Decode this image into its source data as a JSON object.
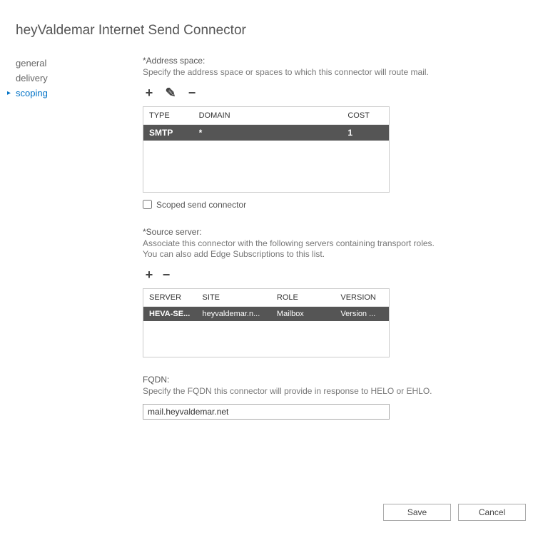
{
  "page_title": "heyValdemar Internet Send Connector",
  "sidebar": {
    "items": [
      {
        "label": "general"
      },
      {
        "label": "delivery"
      },
      {
        "label": "scoping"
      }
    ]
  },
  "address_space": {
    "label": "*Address space:",
    "help": "Specify the address space or spaces to which this connector will route mail.",
    "headers": {
      "type": "TYPE",
      "domain": "DOMAIN",
      "cost": "COST"
    },
    "rows": [
      {
        "type": "SMTP",
        "domain": "*",
        "cost": "1"
      }
    ],
    "scoped_label": "Scoped send connector"
  },
  "source_server": {
    "label": "*Source server:",
    "help": "Associate this connector with the following servers containing transport roles. You can also add Edge Subscriptions to this list.",
    "headers": {
      "server": "SERVER",
      "site": "SITE",
      "role": "ROLE",
      "version": "VERSION"
    },
    "rows": [
      {
        "server": "HEVA-SE...",
        "site": "heyvaldemar.n...",
        "role": "Mailbox",
        "version": "Version ..."
      }
    ]
  },
  "fqdn": {
    "label": "FQDN:",
    "help": "Specify the FQDN this connector will provide in response to HELO or EHLO.",
    "value": "mail.heyvaldemar.net"
  },
  "buttons": {
    "save": "Save",
    "cancel": "Cancel"
  }
}
